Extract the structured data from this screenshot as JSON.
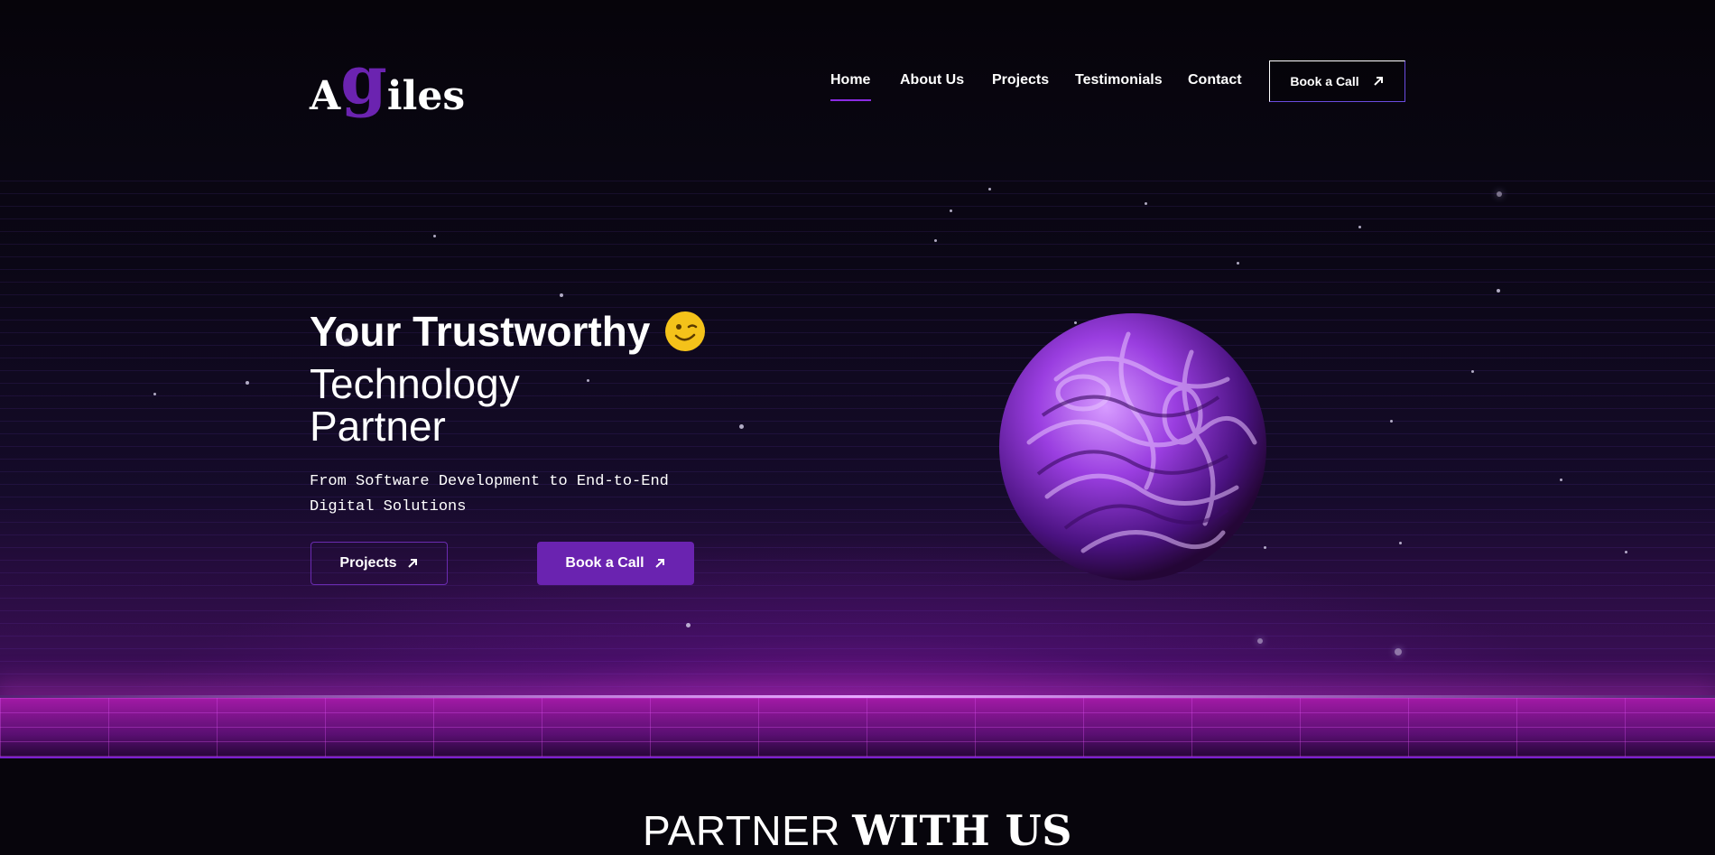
{
  "brand": {
    "logo_part1": "A",
    "logo_part2": "g",
    "logo_part3": "iles",
    "accent_color": "#6b23b0"
  },
  "nav": {
    "items": [
      {
        "label": "Home",
        "active": true
      },
      {
        "label": "About Us"
      },
      {
        "label": "Projects"
      },
      {
        "label": "Testimonials"
      },
      {
        "label": "Contact"
      }
    ],
    "cta_label": "Book a Call",
    "cta_icon": "arrow-up-right-icon"
  },
  "hero": {
    "title_line1": "Your Trustworthy",
    "title_emoji": "winking-face-icon",
    "title_line2": "Technology",
    "title_line3": "Partner",
    "subtitle": "From Software Development to End-to-End Digital Solutions",
    "primary_button": "Projects",
    "secondary_button": "Book a Call",
    "button_color": "#6a23b0"
  },
  "section": {
    "heading_light": "PARTNER",
    "heading_bold": "WITH US"
  }
}
